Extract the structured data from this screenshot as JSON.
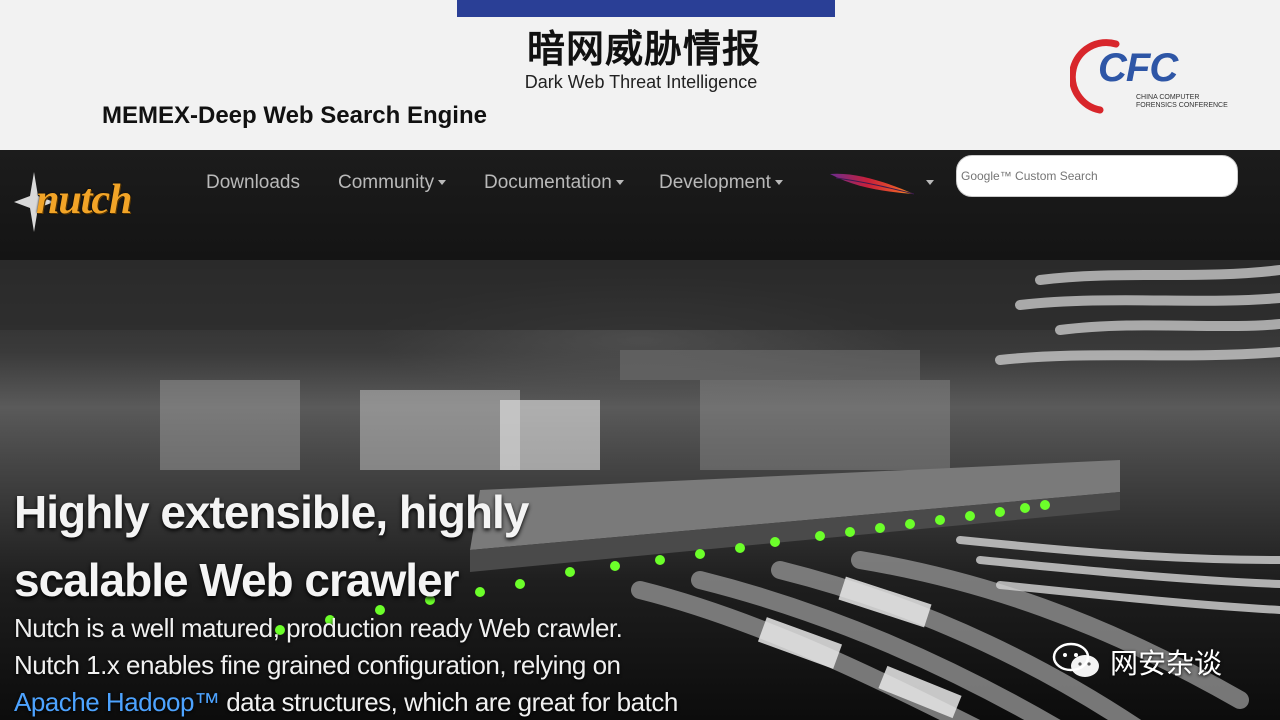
{
  "slide": {
    "title_cn": "暗网威胁情报",
    "subtitle_en": "Dark Web Threat Intelligence",
    "section_title": "MEMEX-Deep Web Search Engine",
    "logo": {
      "text": "CFC",
      "subtext_line1": "CHINA COMPUTER",
      "subtext_line2": "FORENSICS CONFERENCE",
      "colors": {
        "arc": "#d8262b",
        "text": "#2e56a6"
      }
    }
  },
  "site": {
    "logo_text": "nutch",
    "nav": [
      {
        "label": "Downloads",
        "dropdown": false
      },
      {
        "label": "Community",
        "dropdown": true
      },
      {
        "label": "Documentation",
        "dropdown": true
      },
      {
        "label": "Development",
        "dropdown": true
      }
    ],
    "apache_icon": "apache-feather-icon",
    "search": {
      "placeholder": "Google™ Custom Search"
    },
    "hero": {
      "heading_line1": "Highly extensible, highly",
      "heading_line2": "scalable Web crawler",
      "body_line1": "Nutch is a well matured, production ready Web crawler.",
      "body_line2": "Nutch 1.x enables fine grained configuration, relying on",
      "body_link": "Apache Hadoop™",
      "body_line3_rest": " data structures, which are great for batch"
    },
    "colors": {
      "navbar": "#1a1a1a",
      "nav_text": "#b9b9b9",
      "link": "#4da3ff",
      "logo": "#f2a427"
    }
  },
  "watermark": {
    "text": "网安杂谈"
  }
}
